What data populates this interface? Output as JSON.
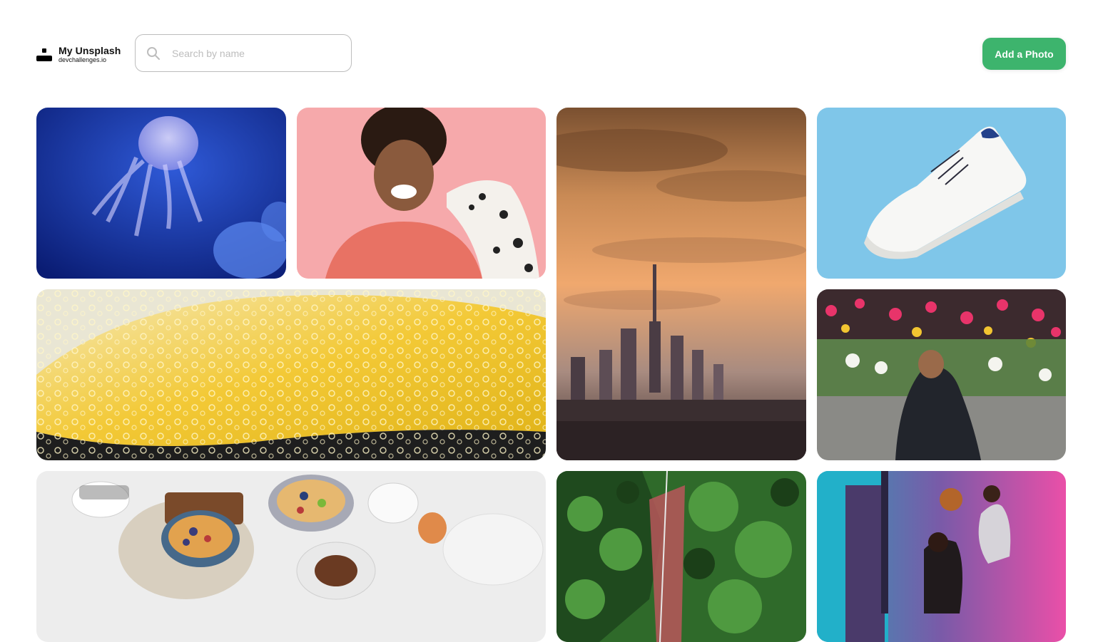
{
  "brand": {
    "title": "My Unsplash",
    "subtitle": "devchallenges.io",
    "icon": "user-icon"
  },
  "search": {
    "placeholder": "Search by name",
    "value": "",
    "icon": "search-icon"
  },
  "actions": {
    "add_photo_label": "Add a Photo",
    "accent_color": "#3db46d"
  },
  "gallery": {
    "photos": [
      {
        "subject": "jellyfish"
      },
      {
        "subject": "woman-with-dalmatian"
      },
      {
        "subject": "city-skyline-sunset"
      },
      {
        "subject": "white-sneaker"
      },
      {
        "subject": "lemon-slices-sparkling-water"
      },
      {
        "subject": "flower-memorial"
      },
      {
        "subject": "breakfast-table"
      },
      {
        "subject": "green-foliage"
      },
      {
        "subject": "basketball-players"
      }
    ]
  }
}
